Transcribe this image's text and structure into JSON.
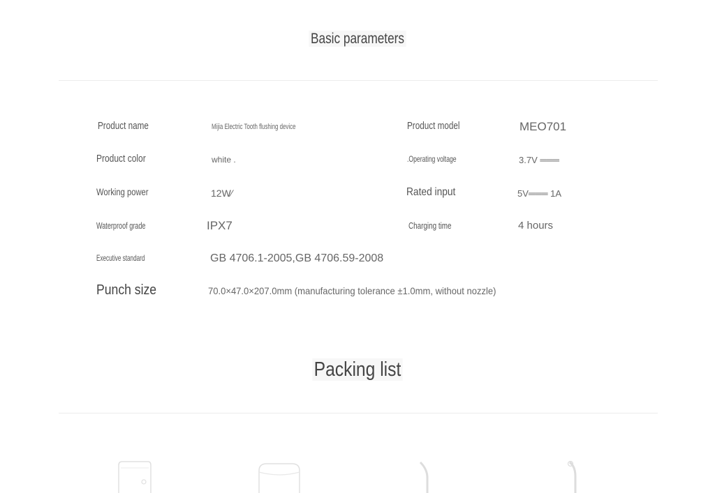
{
  "basic_parameters": {
    "title": "Basic parameters",
    "rows": {
      "product_name": {
        "label": "Product name",
        "value": "Mijia Electric Tooth flushing device"
      },
      "product_model": {
        "label": "Product model",
        "value": "MEO701"
      },
      "product_color": {
        "label": "Product color",
        "value": "white ."
      },
      "operating_voltage": {
        "label": ".Operating voltage",
        "value": "3.7V ═══"
      },
      "working_power": {
        "label": "Working power",
        "value": "12W∕"
      },
      "rated_input": {
        "label": "Rated input",
        "value": "5V═══ 1A"
      },
      "waterproof_grade": {
        "label": "Waterproof grade",
        "value": "IPX7"
      },
      "charging_time": {
        "label": "Charging time",
        "value": "4 hours"
      },
      "executive_standard": {
        "label": "Executive standard",
        "value": "GB 4706.1-2005,GB 4706.59-2008"
      },
      "punch_size": {
        "label": "Punch size",
        "value": "70.0×47.0×207.0mm (manufacturing tolerance ±1.0mm, without nozzle)"
      }
    }
  },
  "packing_list": {
    "title": "Packing list",
    "items": [
      "device-body-icon",
      "water-tank-icon",
      "nozzle-icon",
      "nozzle-icon"
    ]
  }
}
